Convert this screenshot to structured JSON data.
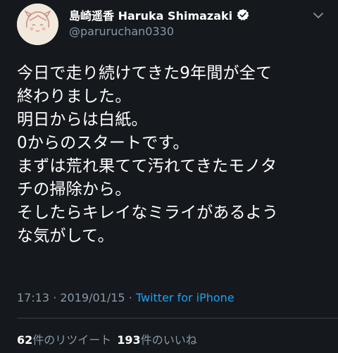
{
  "user": {
    "display_name": "島崎遥香 Haruka Shimazaki",
    "handle": "@paruruchan0330",
    "verified_icon": "verified-badge-icon"
  },
  "tweet": {
    "lines": [
      "今日で走り続けてきた9年間が全て",
      "終わりました。",
      "明日からは白紙。",
      "0からのスタートです。",
      "まずは荒れ果てて汚れてきたモノタ",
      "チの掃除から。",
      "そしたらキレイなミライがあるよう",
      "な気がして。"
    ]
  },
  "meta": {
    "time": "17:13",
    "separator": "·",
    "date": "2019/01/15",
    "source": "Twitter for iPhone"
  },
  "stats": {
    "retweets_count": "62",
    "retweets_label": "件のリツイート",
    "likes_count": "193",
    "likes_label": "件のいいね"
  },
  "colors": {
    "background": "#15181d",
    "text": "#ffffff",
    "secondary": "#8899a6",
    "link": "#1da1f2"
  }
}
